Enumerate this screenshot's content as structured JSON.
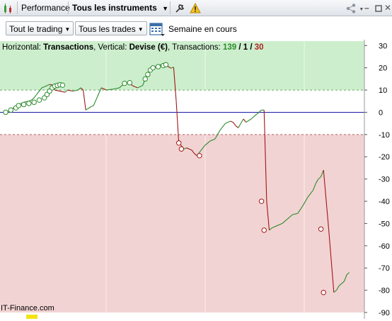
{
  "toolbar": {
    "performance_label": "Performance",
    "instruments_label": "Tous les instruments"
  },
  "options": {
    "trading_dropdown": "Tout le trading",
    "trades_dropdown": "Tous les trades",
    "period_label": "Semaine en cours"
  },
  "chart_header": {
    "horizontal_label": "Horizontal: ",
    "horizontal_value": "Transactions",
    "vertical_label": ", Vertical: ",
    "vertical_value": "Devise (€)",
    "count_label": ", Transactions: ",
    "count_total": "139",
    "count_sep1": " / ",
    "count_wins": "1",
    "count_sep2": " / ",
    "count_losses": "30"
  },
  "watermark": "IT-Finance.com",
  "colors": {
    "positive_zone": "#cdeecd",
    "negative_zone": "#f2d3d3",
    "up_line": "#2c8a2c",
    "down_line": "#a01616",
    "zero_line": "#1a1aa6",
    "count_total_color": "#2e8b2e",
    "count_losses_color": "#b22222"
  },
  "chart_data": {
    "type": "line",
    "ylim": [
      -90,
      32
    ],
    "yticks": [
      30,
      20,
      10,
      0,
      -10,
      -20,
      -30,
      -40,
      -50,
      -60,
      -70,
      -80,
      -90
    ],
    "dashed_thresholds": [
      10,
      -10
    ],
    "zero_line": 0,
    "x_range": [
      1,
      139
    ],
    "grid": false,
    "series": [
      {
        "x": [
          1,
          3,
          4,
          5,
          6,
          7,
          8,
          9,
          10,
          11,
          12,
          13,
          14,
          15,
          16,
          17,
          18,
          19,
          20,
          24,
          25,
          27,
          29,
          30,
          31,
          32,
          34,
          35,
          38,
          40,
          43,
          45,
          47,
          49,
          50,
          51,
          52,
          53,
          54,
          55,
          56,
          57,
          58,
          60,
          61,
          62,
          63,
          64,
          65,
          66,
          67,
          68,
          69,
          70,
          71,
          72,
          73,
          74,
          75,
          76,
          78,
          80,
          82,
          84,
          86,
          88,
          89,
          90,
          91,
          92,
          93,
          94,
          96,
          98,
          100,
          101,
          102,
          103,
          104,
          106,
          108,
          110,
          112,
          114,
          116,
          118,
          120,
          121,
          122,
          123,
          124,
          126,
          128,
          129,
          130,
          131,
          132,
          133,
          134
        ],
        "y": [
          0,
          1,
          2,
          3,
          3.5,
          4,
          4.5,
          4.8,
          5,
          5.5,
          6.5,
          8,
          9.5,
          11,
          11.5,
          12,
          12.5,
          12.3,
          10,
          9,
          10,
          9.5,
          10,
          11,
          10,
          1,
          2.5,
          3,
          11,
          10,
          10.5,
          11,
          13,
          13.3,
          12,
          11.5,
          11,
          11.5,
          12,
          15,
          17,
          19,
          20,
          21,
          21.4,
          21,
          21.2,
          20.5,
          19.8,
          20.3,
          5,
          -13.8,
          -15,
          -16.5,
          -16,
          -16.5,
          -17,
          -18.5,
          -19.5,
          -18,
          -15,
          -13,
          -12,
          -8,
          -5,
          -4,
          -4.5,
          -6,
          -7,
          -5,
          -3,
          -4.5,
          -3,
          -1,
          1,
          1,
          -40,
          -53,
          -52,
          -51,
          -50,
          -48,
          -46,
          -45.5,
          -42,
          -38,
          -35,
          -32,
          -30,
          -29,
          -26,
          -52.5,
          -81,
          -80,
          -78,
          -77,
          -76,
          -73,
          -72
        ]
      }
    ],
    "markers": [
      {
        "x": 1,
        "y": 0
      },
      {
        "x": 3,
        "y": 1
      },
      {
        "x": 5,
        "y": 2
      },
      {
        "x": 6,
        "y": 3
      },
      {
        "x": 8,
        "y": 3.5
      },
      {
        "x": 10,
        "y": 4
      },
      {
        "x": 12,
        "y": 4.5
      },
      {
        "x": 14,
        "y": 5.5
      },
      {
        "x": 16,
        "y": 6.5
      },
      {
        "x": 17,
        "y": 8
      },
      {
        "x": 18,
        "y": 9.5
      },
      {
        "x": 19,
        "y": 11
      },
      {
        "x": 20,
        "y": 11.8
      },
      {
        "x": 21,
        "y": 12.1
      },
      {
        "x": 22,
        "y": 12.4
      },
      {
        "x": 23,
        "y": 12.2
      },
      {
        "x": 47,
        "y": 13
      },
      {
        "x": 49,
        "y": 13.3
      },
      {
        "x": 55,
        "y": 15
      },
      {
        "x": 56,
        "y": 17
      },
      {
        "x": 57,
        "y": 19
      },
      {
        "x": 58,
        "y": 20
      },
      {
        "x": 60,
        "y": 20.5
      },
      {
        "x": 62,
        "y": 21
      },
      {
        "x": 63,
        "y": 21.4
      },
      {
        "x": 68,
        "y": -13.8
      },
      {
        "x": 69,
        "y": -16.5
      },
      {
        "x": 76,
        "y": -19.5
      },
      {
        "x": 100,
        "y": -40
      },
      {
        "x": 101,
        "y": -53
      },
      {
        "x": 123,
        "y": -52.5
      },
      {
        "x": 124,
        "y": -81
      }
    ]
  }
}
